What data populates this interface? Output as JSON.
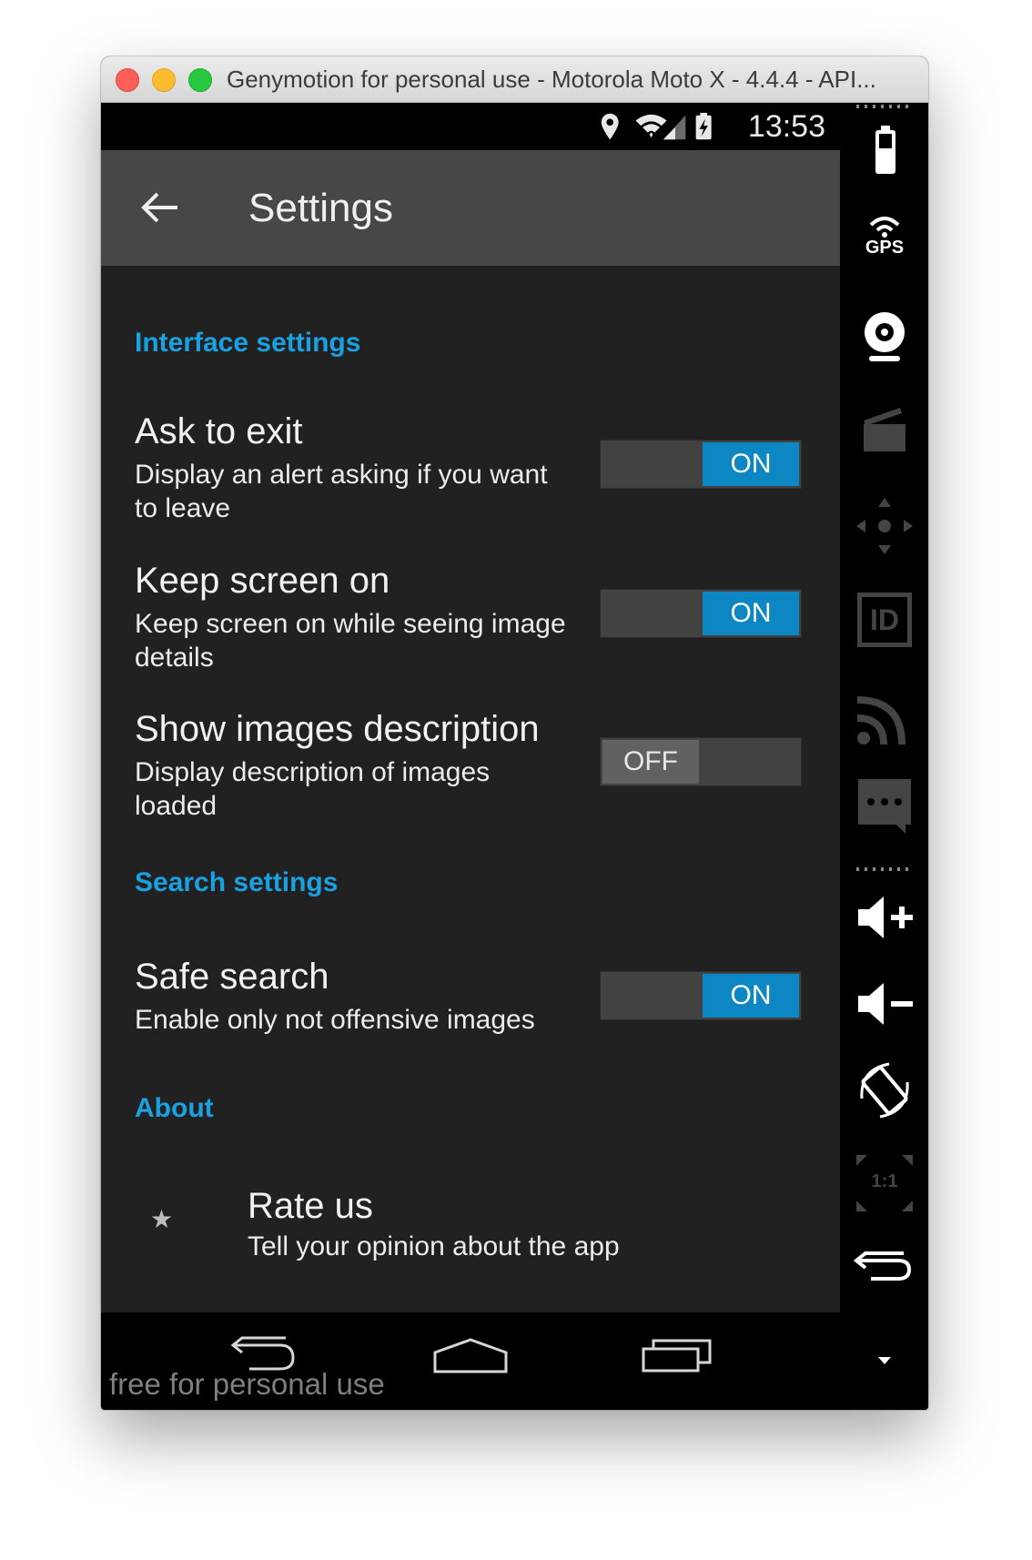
{
  "window": {
    "title": "Genymotion for personal use - Motorola Moto X - 4.4.4 - API..."
  },
  "status_bar": {
    "time": "13:53",
    "icons": [
      "location-icon",
      "wifi-icon",
      "signal-icon",
      "battery-charging-icon"
    ]
  },
  "action_bar": {
    "back_icon": "back-arrow-icon",
    "title": "Settings"
  },
  "sections": {
    "interface": {
      "header": "Interface settings",
      "prefs": [
        {
          "title": "Ask to exit",
          "summary": "Display an alert asking if you want to leave",
          "toggle": "ON",
          "enabled": true
        },
        {
          "title": "Keep screen on",
          "summary": "Keep screen on while seeing image details",
          "toggle": "ON",
          "enabled": true
        },
        {
          "title": "Show images description",
          "summary": "Display description of images loaded",
          "toggle": "OFF",
          "enabled": false
        }
      ]
    },
    "search": {
      "header": "Search settings",
      "prefs": [
        {
          "title": "Safe search",
          "summary": "Enable only not offensive images",
          "toggle": "ON",
          "enabled": true
        }
      ]
    },
    "about": {
      "header": "About",
      "prefs": [
        {
          "title": "Rate us",
          "summary": "Tell your opinion about the app",
          "icon": "star-icon"
        }
      ]
    }
  },
  "nav_bar": {
    "icons": [
      "nav-back-icon",
      "nav-home-icon",
      "nav-recents-icon"
    ],
    "watermark": "free for personal use"
  },
  "genymotion_sidebar": {
    "icons": [
      "battery-icon",
      "gps-icon",
      "webcam-icon",
      "screencast-icon",
      "dpad-icon",
      "device-id-icon",
      "remote-control-icon",
      "sms-icon",
      "volume-up-icon",
      "volume-down-icon",
      "rotate-icon",
      "pixel-perfect-icon",
      "back-icon",
      "menu-more-icon"
    ],
    "gps_label": "GPS",
    "id_label": "ID",
    "scale_label": "1:1"
  },
  "colors": {
    "accent": "#1ba1e2",
    "toggle_on": "#0c87c3",
    "background": "#212121",
    "action_bar": "#474747"
  }
}
